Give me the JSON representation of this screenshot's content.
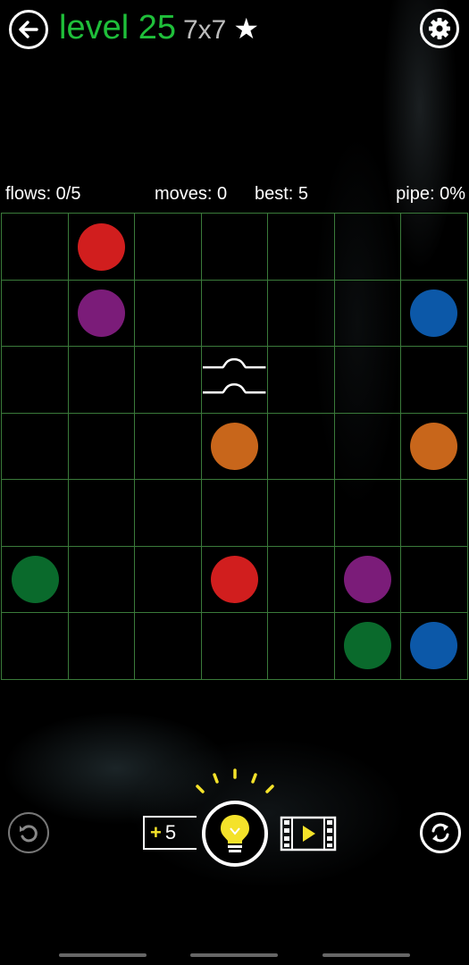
{
  "header": {
    "level_label": "level 25",
    "size_label": "7x7",
    "star_glyph": "★",
    "back_icon": "back-arrow-icon",
    "settings_icon": "gear-icon"
  },
  "stats": {
    "flows": "flows: 0/5",
    "moves": "moves: 0",
    "best": "best: 5",
    "pipe": "pipe: 0%"
  },
  "board": {
    "rows": 7,
    "cols": 7,
    "grid_color": "#3a7a3a",
    "dots": [
      {
        "row": 0,
        "col": 1,
        "color": "red"
      },
      {
        "row": 1,
        "col": 1,
        "color": "purple"
      },
      {
        "row": 1,
        "col": 6,
        "color": "blue"
      },
      {
        "row": 3,
        "col": 3,
        "color": "orange"
      },
      {
        "row": 3,
        "col": 6,
        "color": "orange"
      },
      {
        "row": 5,
        "col": 0,
        "color": "green"
      },
      {
        "row": 5,
        "col": 3,
        "color": "red"
      },
      {
        "row": 5,
        "col": 5,
        "color": "purple"
      },
      {
        "row": 6,
        "col": 5,
        "color": "green"
      },
      {
        "row": 6,
        "col": 6,
        "color": "blue"
      }
    ],
    "bridges": [
      {
        "row": 2,
        "col": 3
      }
    ]
  },
  "colors": {
    "red": "#d11e1e",
    "purple": "#7b1c79",
    "blue": "#0c58a8",
    "orange": "#c8661b",
    "green": "#0a6a2c",
    "level_green": "#1fbf3a",
    "hint_yellow": "#f4e22a"
  },
  "footer": {
    "hint_count": "5",
    "plus_sign": "+",
    "undo_icon": "undo-icon",
    "hint_icon": "lightbulb-icon",
    "video_icon": "video-reward-icon",
    "restart_icon": "restart-icon"
  }
}
